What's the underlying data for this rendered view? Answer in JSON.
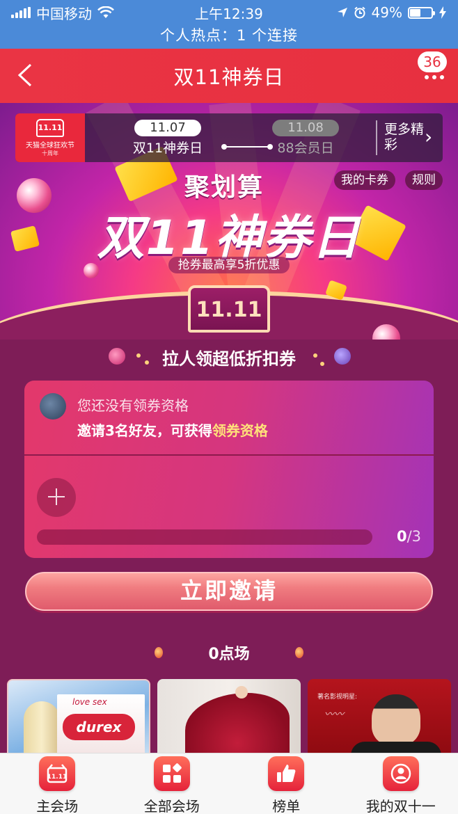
{
  "status_bar": {
    "carrier": "中国移动",
    "time": "上午12:39",
    "battery": "49%",
    "battery_level": 0.49,
    "hotspot": "个人热点：1 个连接"
  },
  "nav": {
    "title": "双11神券日",
    "badge": "36"
  },
  "banner": {
    "logo_mark": "11.11",
    "logo_text": "天猫全球狂欢节",
    "logo_sub": "十周年",
    "date_active": "11.07",
    "label_active": "双11神券日",
    "date_inactive": "11.08",
    "label_inactive": "88会员日",
    "more": "更多精彩",
    "my_coupons": "我的卡券",
    "rules": "规则",
    "brand": "聚划算",
    "headline": "双11神券日",
    "subline": "抢券最高享5折优惠",
    "event_logo": "11.11"
  },
  "invite": {
    "title": "拉人领超低折扣券",
    "no_qualification": "您还没有领券资格",
    "invite_prefix": "邀请3名好友，可获得",
    "invite_highlight": "领券资格",
    "progress_current": "0",
    "progress_total": "/3",
    "progress_value": 0,
    "button": "立即邀请"
  },
  "session": {
    "title": "0点场"
  },
  "products": [
    {
      "brand_small": "love sex",
      "brand": "durex"
    },
    {
      "name": ""
    },
    {
      "caption": "著名影视明星:"
    }
  ],
  "tabbar": [
    {
      "label": "主会场",
      "icon": "1111-icon"
    },
    {
      "label": "全部会场",
      "icon": "grid-icon"
    },
    {
      "label": "榜单",
      "icon": "thumbs-up-icon"
    },
    {
      "label": "我的双十一",
      "icon": "user-icon"
    }
  ],
  "colors": {
    "status_bar": "#4b8ad8",
    "nav_bar": "#e7303f",
    "page_bg": "#7e1d57",
    "highlight": "#ffe27a"
  }
}
